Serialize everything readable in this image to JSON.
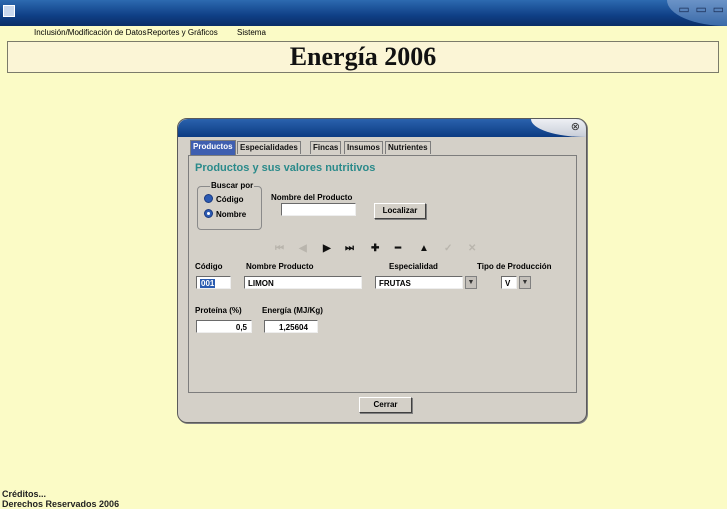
{
  "menu": {
    "items": [
      {
        "label": "Inclusión/Modificación de Datos"
      },
      {
        "label": "Reportes y Gráficos"
      },
      {
        "label": "Sistema"
      }
    ]
  },
  "header": {
    "title": "Energía 2006"
  },
  "window_buttons": "▭ ▭ ▭",
  "dialog": {
    "close_glyph": "⊗",
    "tabs": [
      {
        "label": "Productos",
        "active": true
      },
      {
        "label": "Especialidades"
      },
      {
        "label": "Fincas"
      },
      {
        "label": "Insumos"
      },
      {
        "label": "Nutrientes"
      }
    ],
    "heading": "Productos y sus valores nutritivos",
    "search": {
      "group_label": "Buscar por",
      "option_code": "Código",
      "option_name": "Nombre",
      "selected": "Nombre",
      "name_label": "Nombre del Producto",
      "name_value": "",
      "locate_button": "Localizar"
    },
    "nav_glyphs": [
      "⏮",
      "◀",
      "▶",
      "⏭",
      "✚",
      "━",
      "▲",
      "✓",
      "✕"
    ],
    "fields": {
      "code_label": "Código",
      "code_value": "001",
      "product_label": "Nombre Producto",
      "product_value": "LIMON",
      "specialty_label": "Especialidad",
      "specialty_value": "FRUTAS",
      "prodtype_label": "Tipo de Producción",
      "prodtype_value": "V",
      "protein_label": "Proteína (%)",
      "protein_value": "0,5",
      "energy_label": "Energía (MJ/Kg)",
      "energy_value": "1,25604"
    },
    "close_button": "Cerrar"
  },
  "footer": {
    "credits": "Créditos...",
    "rights": "Derechos Reservados 2006"
  },
  "colors": {
    "background": "#fbfbc6",
    "titlebar": "#0f3f86",
    "heading": "#2a8a8a",
    "active_tab": "#3f5fb0"
  }
}
